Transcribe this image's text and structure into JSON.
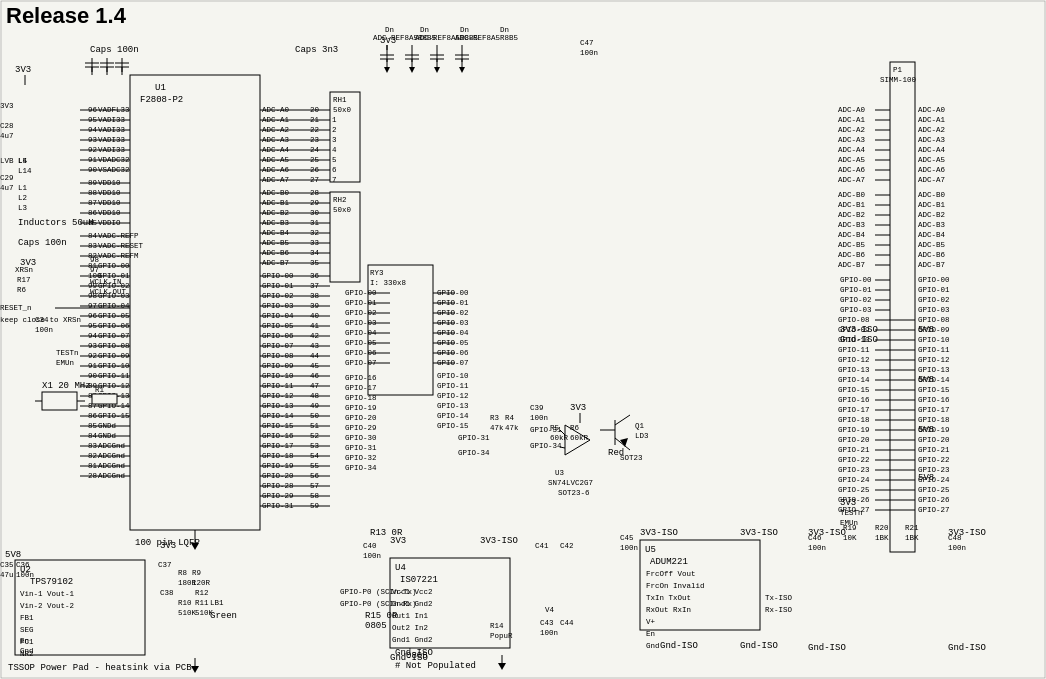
{
  "title": "Release 1.4",
  "schematic": {
    "main_ic": "U1 F280K-P2",
    "power_reg": "U2 TPS79102",
    "iso_ic": "U5 ADUM221",
    "usb_ic": "U4 IS07221",
    "buffer_ic": "U3 SN74LVC2G7 SOT23-6",
    "connector": "P1 SIMM-100",
    "crystal": "X1 20 MHz",
    "voltage_3v3": "3V3",
    "voltage_5v8": "5V8",
    "voltage_iso": "3V3-ISO",
    "caps_100n": "Caps 100n",
    "caps_3n3": "Caps 3n3",
    "inductors": "Inductors 50uH",
    "reset_note": "keep close to XRSn",
    "heatsink_note": "TSSOP Power Pad - heatsink via PCB",
    "not_populated": "# Not Populated",
    "footprint_0805": "0805",
    "led_green": "Green",
    "led_red": "Red",
    "pin_count": "100 pin LQFP",
    "gnd_iso": "Gnd-ISO"
  }
}
